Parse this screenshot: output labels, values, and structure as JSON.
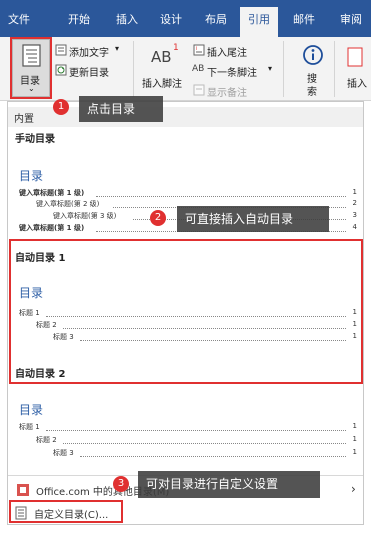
{
  "tabs": [
    "文件",
    "开始",
    "插入",
    "设计",
    "布局",
    "引用",
    "邮件",
    "审阅"
  ],
  "active_tab_index": 5,
  "ribbon": {
    "toc_button": "目录",
    "add_text": "添加文字",
    "add_text_arrow": "▾",
    "update_toc": "更新目录",
    "footnote_main": "AB",
    "footnote_sup": "1",
    "insert_footnote": "插入脚注",
    "insert_endnote": "插入尾注",
    "next_footnote": "下一条脚注",
    "next_footnote_arrow": "▾",
    "show_notes": "显示备注",
    "search": "搜\n索",
    "insert_citation": "插入"
  },
  "dropdown": {
    "builtin_header": "内置",
    "manual_title": "手动目录",
    "manual_toc_heading": "目录",
    "manual_entries": [
      {
        "text": "键入章标题(第 1 级)",
        "page": "1"
      },
      {
        "text": "键入章标题(第 2 级)",
        "page": "2"
      },
      {
        "text": "键入章标题(第 3 级)",
        "page": "3"
      },
      {
        "text": "键入章标题(第 1 级)",
        "page": "4"
      }
    ],
    "auto1_title": "自动目录 1",
    "auto1_toc_heading": "目录",
    "auto1_entries": [
      {
        "text": "标题 1",
        "page": "1"
      },
      {
        "text": "标题 2",
        "page": "1"
      },
      {
        "text": "标题 3",
        "page": "1"
      }
    ],
    "auto2_title": "自动目录 2",
    "auto2_toc_heading": "目录",
    "auto2_entries": [
      {
        "text": "标题 1",
        "page": "1"
      },
      {
        "text": "标题 2",
        "page": "1"
      },
      {
        "text": "标题 3",
        "page": "1"
      }
    ],
    "office_item": "Office.com 中的其他目录(M)",
    "office_arrow": "›",
    "custom_item": "自定义目录(C)..."
  },
  "callouts": [
    {
      "num": "1",
      "text": "点击目录"
    },
    {
      "num": "2",
      "text": "可直接插入自动目录"
    },
    {
      "num": "3",
      "text": "可对目录进行自定义设置"
    }
  ],
  "colors": {
    "ribbon_blue": "#2b579a",
    "highlight_red": "#e03030",
    "toc_blue": "#2e5fa6"
  }
}
